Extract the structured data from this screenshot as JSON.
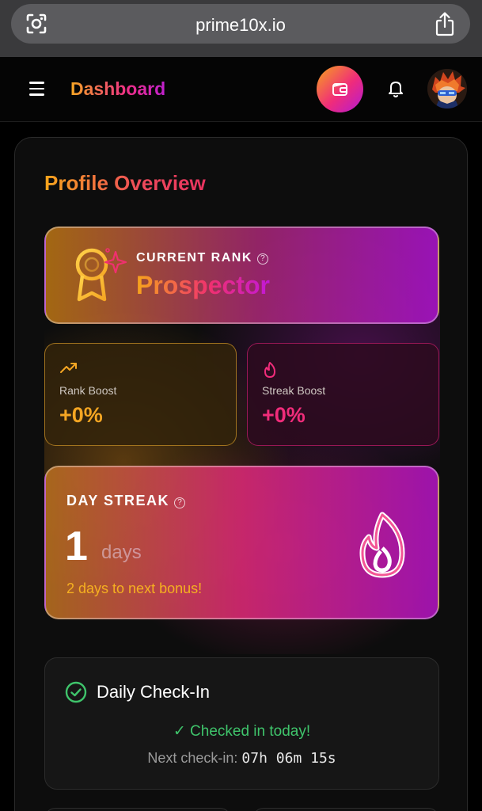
{
  "browser": {
    "url": "prime10x.io"
  },
  "header": {
    "title": "Dashboard",
    "accent_gradient": [
      "#f7a51b",
      "#f02c7a",
      "#b21ad6"
    ]
  },
  "profile": {
    "section_title": "Profile Overview",
    "rank": {
      "label": "CURRENT RANK",
      "name": "Prospector",
      "help": "?"
    },
    "boosts": [
      {
        "label": "Rank Boost",
        "value": "+0%",
        "icon": "trending-up-icon",
        "color": "#f5a623"
      },
      {
        "label": "Streak Boost",
        "value": "+0%",
        "icon": "flame-icon",
        "color": "#f02c7a"
      }
    ],
    "streak": {
      "label": "DAY STREAK",
      "help": "?",
      "count": "1",
      "unit": "days",
      "bonus_text": "2 days to next bonus!"
    },
    "checkin": {
      "title": "Daily Check-In",
      "status": "✓ Checked in today!",
      "next_label": "Next check-in:",
      "countdown": "07h 06m 15s",
      "status_color": "#3fc46b"
    }
  }
}
